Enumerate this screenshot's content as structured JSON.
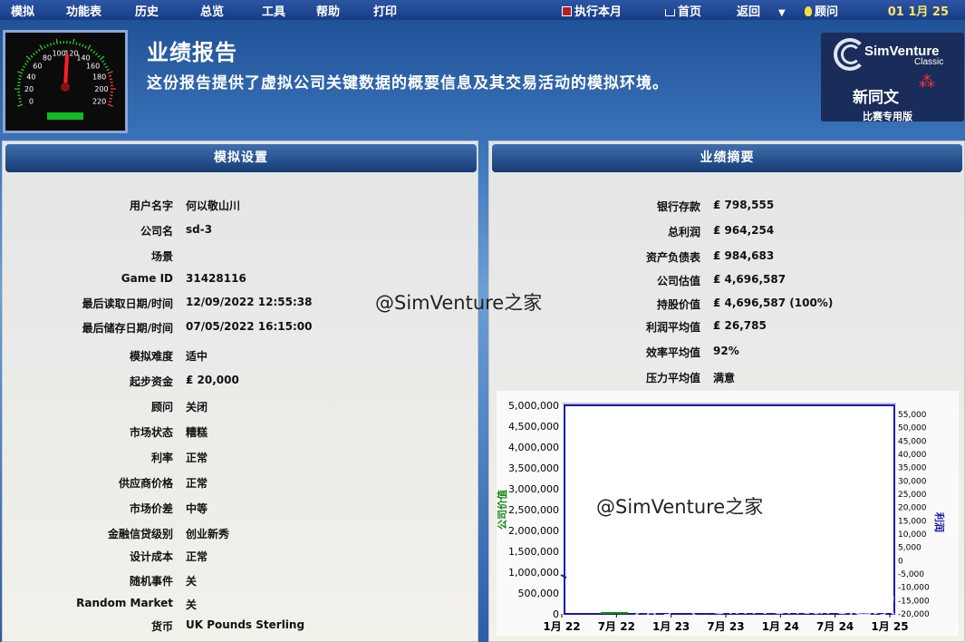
{
  "menu": {
    "items": [
      "模拟",
      "功能表",
      "历史",
      "总览",
      "工具",
      "帮助",
      "打印"
    ],
    "run_month": "执行本月",
    "home": "首页",
    "back": "返回",
    "advisor": "顾问",
    "date": "01 1月 25"
  },
  "header": {
    "title": "业绩报告",
    "subtitle": "这份报告提供了虚拟公司关键数据的概要信息及其交易活动的模拟环境。",
    "gauge_ticks": [
      "0",
      "20",
      "40",
      "60",
      "80",
      "100",
      "120",
      "140",
      "160",
      "180",
      "200",
      "220"
    ]
  },
  "logo": {
    "brand": "SimVenture",
    "sub": "Classic",
    "name": "新同文",
    "edition": "比赛专用版"
  },
  "settings": {
    "title": "模拟设置",
    "rows": [
      {
        "label": "用户名字",
        "value": "何以敬山川"
      },
      {
        "label": "公司名",
        "value": "sd-3"
      },
      {
        "label": "场景",
        "value": ""
      },
      {
        "label": "Game ID",
        "value": "31428116"
      },
      {
        "label": "最后读取日期/时间",
        "value": "12/09/2022 12:55:38"
      },
      {
        "label": "最后储存日期/时间",
        "value": "07/05/2022 16:15:00"
      },
      {
        "label": "模拟难度",
        "value": "适中"
      },
      {
        "label": "起步资金",
        "value": "₤ 20,000"
      },
      {
        "label": "顾问",
        "value": "关闭"
      },
      {
        "label": "市场状态",
        "value": "糟糕"
      },
      {
        "label": "利率",
        "value": "正常"
      },
      {
        "label": "供应商价格",
        "value": "正常"
      },
      {
        "label": "市场价差",
        "value": "中等"
      },
      {
        "label": "金融信贷级别",
        "value": "创业新秀"
      },
      {
        "label": "设计成本",
        "value": "正常"
      },
      {
        "label": "随机事件",
        "value": "关"
      },
      {
        "label": "Random Market",
        "value": "关"
      },
      {
        "label": "货币",
        "value": "UK Pounds Sterling"
      }
    ]
  },
  "summary": {
    "title": "业绩摘要",
    "rows": [
      {
        "label": "银行存款",
        "value": "₤ 798,555"
      },
      {
        "label": "总利润",
        "value": "₤ 964,254"
      },
      {
        "label": "资产负债表",
        "value": "₤ 984,683"
      },
      {
        "label": "公司估值",
        "value": "₤ 4,696,587"
      },
      {
        "label": "持股价值",
        "value": "₤ 4,696,587 (100%)"
      },
      {
        "label": "利润平均值",
        "value": "₤ 26,785"
      },
      {
        "label": "效率平均值",
        "value": "92%"
      },
      {
        "label": "压力平均值",
        "value": "满意"
      }
    ]
  },
  "watermarks": [
    "@SimVenture之家",
    "@SimVenture之家",
    "知乎 @SimVenture之家"
  ],
  "chart_data": {
    "type": "line",
    "ylabel": "公司价值",
    "y2label": "利润",
    "left_ticks": [
      "5,000,000",
      "4,500,000",
      "4,000,000",
      "3,500,000",
      "3,000,000",
      "2,500,000",
      "2,000,000",
      "1,500,000",
      "1,000,000",
      "500,000",
      "0"
    ],
    "right_ticks": [
      "55,000",
      "50,000",
      "45,000",
      "40,000",
      "35,000",
      "30,000",
      "25,000",
      "20,000",
      "15,000",
      "10,000",
      "5,000",
      "0",
      "-5,000",
      "-10,000",
      "-15,000",
      "-20,000"
    ],
    "x_ticks": [
      "1月 22",
      "7月 22",
      "1月 23",
      "7月 23",
      "1月 24",
      "7月 24",
      "1月 25"
    ],
    "ylim": [
      0,
      5000000
    ],
    "y2lim": [
      -20000,
      55000
    ],
    "colors": {
      "left_axis": "#118811",
      "right_axis": "#1a1aa8",
      "plot_border": "#1a1aa8"
    }
  }
}
